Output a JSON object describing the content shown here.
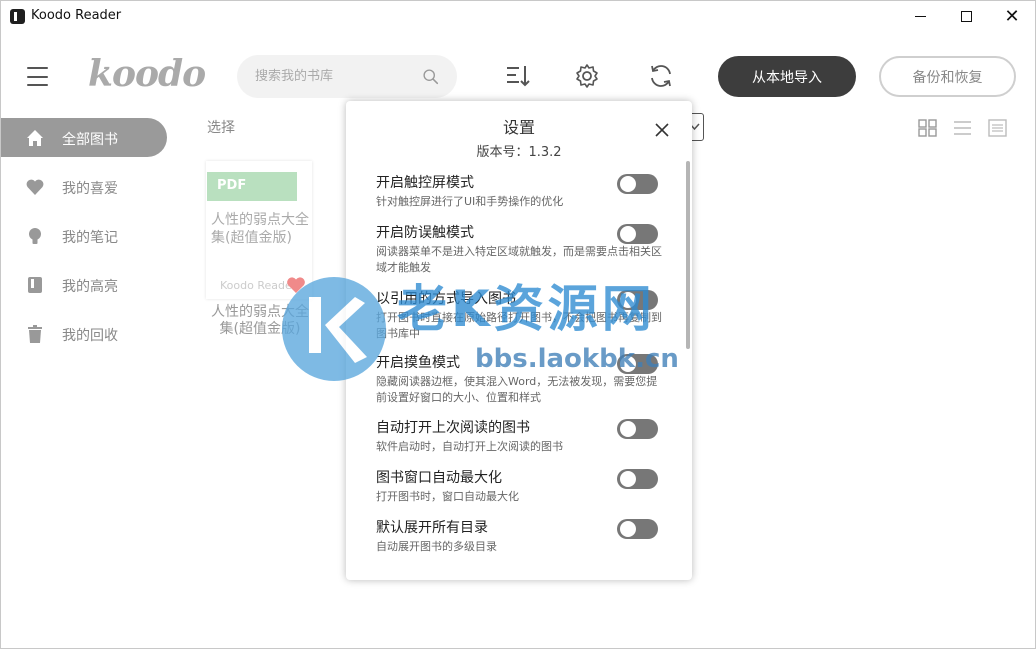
{
  "window": {
    "title": "Koodo Reader",
    "close_glyph": "✕"
  },
  "header": {
    "logo": "koodo",
    "search_placeholder": "搜索我的书库",
    "import_label": "从本地导入",
    "backup_label": "备份和恢复"
  },
  "sidebar": {
    "items": [
      {
        "label": "全部图书",
        "icon": "home-icon",
        "active": true
      },
      {
        "label": "我的喜爱",
        "icon": "heart-icon",
        "active": false
      },
      {
        "label": "我的笔记",
        "icon": "bulb-icon",
        "active": false
      },
      {
        "label": "我的高亮",
        "icon": "highlight-book-icon",
        "active": false
      },
      {
        "label": "我的回收",
        "icon": "trash-icon",
        "active": false
      }
    ]
  },
  "main": {
    "select_label": "选择",
    "book": {
      "format": "PDF",
      "cover_title": "人性的弱点大全集(超值金版)",
      "author": "Koodo Reader",
      "caption": "人性的弱点大全集(超值金版)"
    }
  },
  "settings": {
    "title": "设置",
    "version": "版本号：1.3.2",
    "options": [
      {
        "title": "开启触控屏模式",
        "desc": "针对触控屏进行了UI和手势操作的优化"
      },
      {
        "title": "开启防误触模式",
        "desc": "阅读器菜单不是进入特定区域就触发，而是需要点击相关区域才能触发"
      },
      {
        "title": "以引用的方式导入图书",
        "desc": "打开图书时直接在原始路径打开图书，不会把图书再复制到图书库中"
      },
      {
        "title": "开启摸鱼模式",
        "desc": "隐藏阅读器边框，使其混入Word，无法被发现，需要您提前设置好窗口的大小、位置和样式"
      },
      {
        "title": "自动打开上次阅读的图书",
        "desc": "软件启动时，自动打开上次阅读的图书"
      },
      {
        "title": "图书窗口自动最大化",
        "desc": "打开图书时，窗口自动最大化"
      },
      {
        "title": "默认展开所有目录",
        "desc": "自动展开图书的多级目录"
      }
    ],
    "close_glyph": "✕"
  },
  "watermark": {
    "cn": "老K资源网",
    "url": "bbs.laokbk.cn"
  },
  "colors": {
    "active_sidebar": "#9a9a9a",
    "import_button": "#3d3d3d",
    "pdf_badge": "#b9e0bf",
    "toggle": "#777777"
  }
}
